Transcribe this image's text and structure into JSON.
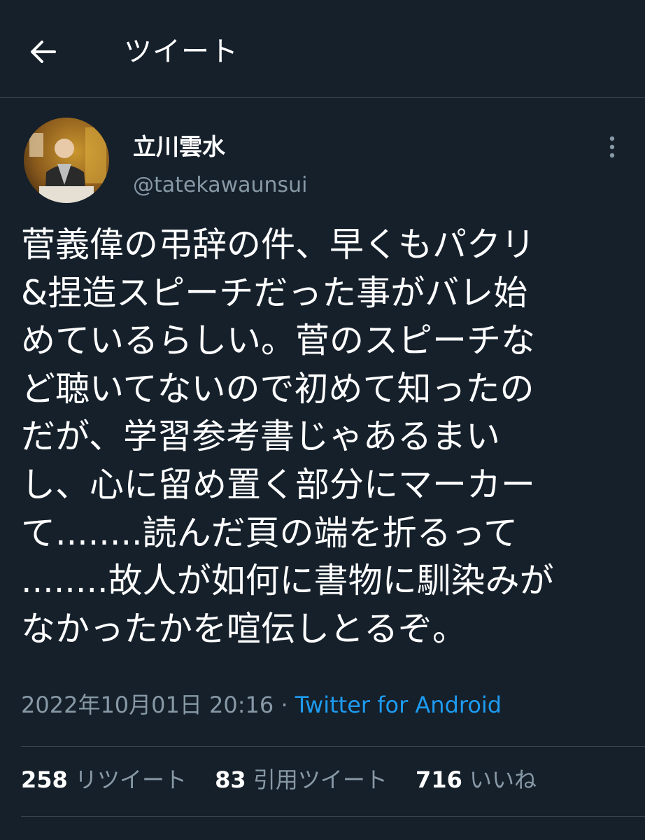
{
  "header": {
    "back_icon": "arrow-left-icon",
    "title": "ツイート"
  },
  "author": {
    "display_name": "立川雲水",
    "handle": "@tatekawaunsui"
  },
  "more_icon": "vertical-ellipsis-icon",
  "tweet": {
    "text": "菅義偉の弔辞の件、早くもパクリ\n&捏造スピーチだった事がバレ始\nめているらしい。菅のスピーチな\nど聴いてないので初めて知ったの\nだが、学習参考書じゃあるまい\nし、心に留め置く部分にマーカー\nて........読んだ頁の端を折るって\n........故人が如何に書物に馴染みが\nなかったかを喧伝しとるぞ。",
    "timestamp": "2022年10月01日 20:16",
    "separator": "·",
    "source": "Twitter for Android"
  },
  "stats": {
    "retweets": {
      "count": "258",
      "label": "リツイート"
    },
    "quotes": {
      "count": "83",
      "label": "引用ツイート"
    },
    "likes": {
      "count": "716",
      "label": "いいね"
    }
  },
  "colors": {
    "background": "#15202b",
    "secondary_text": "#8899a6",
    "link": "#1d9bf0",
    "divider": "#38444d"
  }
}
